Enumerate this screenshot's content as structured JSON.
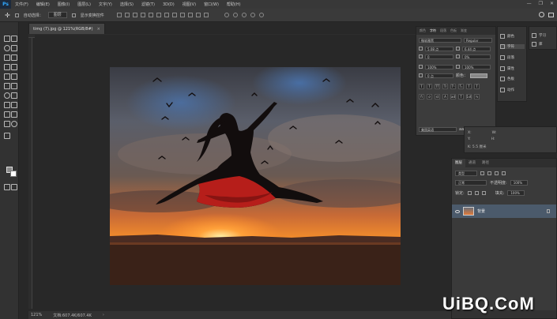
{
  "menubar": {
    "logo": "Ps",
    "items": [
      "文件(F)",
      "编辑(E)",
      "图像(I)",
      "图层(L)",
      "文字(Y)",
      "选择(S)",
      "滤镜(T)",
      "3D(D)",
      "视图(V)",
      "窗口(W)",
      "帮助(H)"
    ],
    "win_controls": [
      "—",
      "❐",
      "✕"
    ]
  },
  "options": {
    "tool_glyph": "✛",
    "auto_select_label": "自动选择：",
    "auto_select_value": "图层",
    "show_transform_label": "显示变换控件"
  },
  "document": {
    "tab_title": "timg (7).jpg @ 121%(RGB/8#)",
    "tab_close": "×",
    "zoom": "121%",
    "doc_size": "文档:607.4K/607.4K"
  },
  "character_panel": {
    "tabs": [
      "颜色",
      "字符",
      "段落",
      "色板",
      "渐变"
    ],
    "font_family": "微软雅黑",
    "font_style": "Regular",
    "font_size": "5.08 点",
    "leading": "6.44 点",
    "kerning": "0",
    "tracking": "0%",
    "vertical_scale": "100%",
    "horizontal_scale": "100%",
    "baseline": "0 点",
    "color_label": "颜色：",
    "style_buttons": [
      "T",
      "T",
      "TT",
      "Tr",
      "T¹",
      "T₁",
      "T",
      "T"
    ],
    "ot_buttons": [
      "fi",
      "ơ",
      "st",
      "A",
      "ad",
      "T",
      "1st",
      "½"
    ],
    "language": "美国英语",
    "antialias_label": "aa",
    "antialias": "锐利"
  },
  "side_strip": {
    "items": [
      "颜色",
      "字符",
      "段落",
      "属性",
      "色板",
      "动作"
    ]
  },
  "learn_strip": {
    "items": [
      "学习",
      "库"
    ]
  },
  "info_panel": {
    "rows": [
      [
        "X:",
        "W:"
      ],
      [
        "Y:",
        "H:"
      ]
    ],
    "status": "K: 5.5 厘米"
  },
  "layers_panel": {
    "tabs": [
      "图层",
      "通道",
      "路径"
    ],
    "filter_label": "类型",
    "blend_mode": "正常",
    "opacity_label": "不透明度:",
    "opacity_value": "100%",
    "lock_label": "锁定:",
    "fill_label": "填充:",
    "fill_value": "100%",
    "layer_name": "背景"
  },
  "watermark": {
    "text": "UiBQ.CoM"
  },
  "colors": {
    "menubar": "#383838",
    "panel": "#3a3a3a",
    "canvas_bg": "#282828",
    "layer_selected": "#4b5a6b",
    "dress_red": "#b61e1a",
    "sun": "#ff8a2a"
  }
}
